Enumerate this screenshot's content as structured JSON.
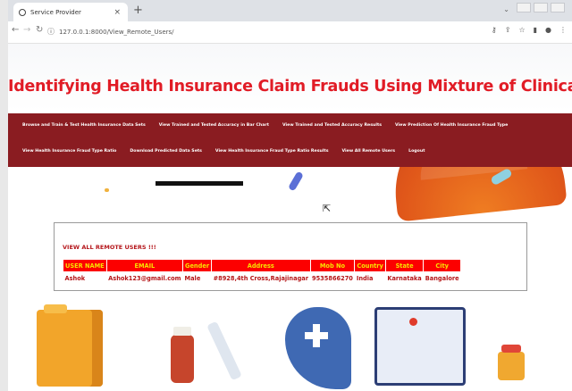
{
  "browser": {
    "tab_title": "Service Provider",
    "tab_close": "×",
    "new_tab": "+",
    "url": "127.0.0.1:8000/View_Remote_Users/"
  },
  "site": {
    "title": "Identifying Health Insurance Claim Frauds Using Mixture of Clinical Concepts"
  },
  "nav": {
    "row1": [
      "Browse and Train & Test Health Insurance Data Sets",
      "View Trained and Tested Accuracy in Bar Chart",
      "View Trained and Tested Accuracy Results",
      "View Prediction Of Health Insurance Fraud Type"
    ],
    "row2": [
      "View Health Insurance Fraud Type Ratio",
      "Download Predicted Data Sets",
      "View Health Insurance Fraud Type Ratio Results",
      "View All Remote Users",
      "Logout"
    ]
  },
  "panel": {
    "title": "VIEW ALL REMOTE USERS !!!",
    "columns": [
      "USER NAME",
      "EMAIL",
      "Gender",
      "Address",
      "Mob No",
      "Country",
      "State",
      "City"
    ],
    "rows": [
      [
        "Ashok",
        "Ashok123@gmail.com",
        "Male",
        "#8928,4th Cross,Rajajinagar",
        "9535866270",
        "India",
        "Karnataka",
        "Bangalore"
      ]
    ]
  },
  "colors": {
    "title_red": "#e11c26",
    "menu_bg": "#8a1c21",
    "header_cell_bg": "#fc0000",
    "header_cell_text": "#f7e200",
    "cell_text": "#b51416"
  }
}
